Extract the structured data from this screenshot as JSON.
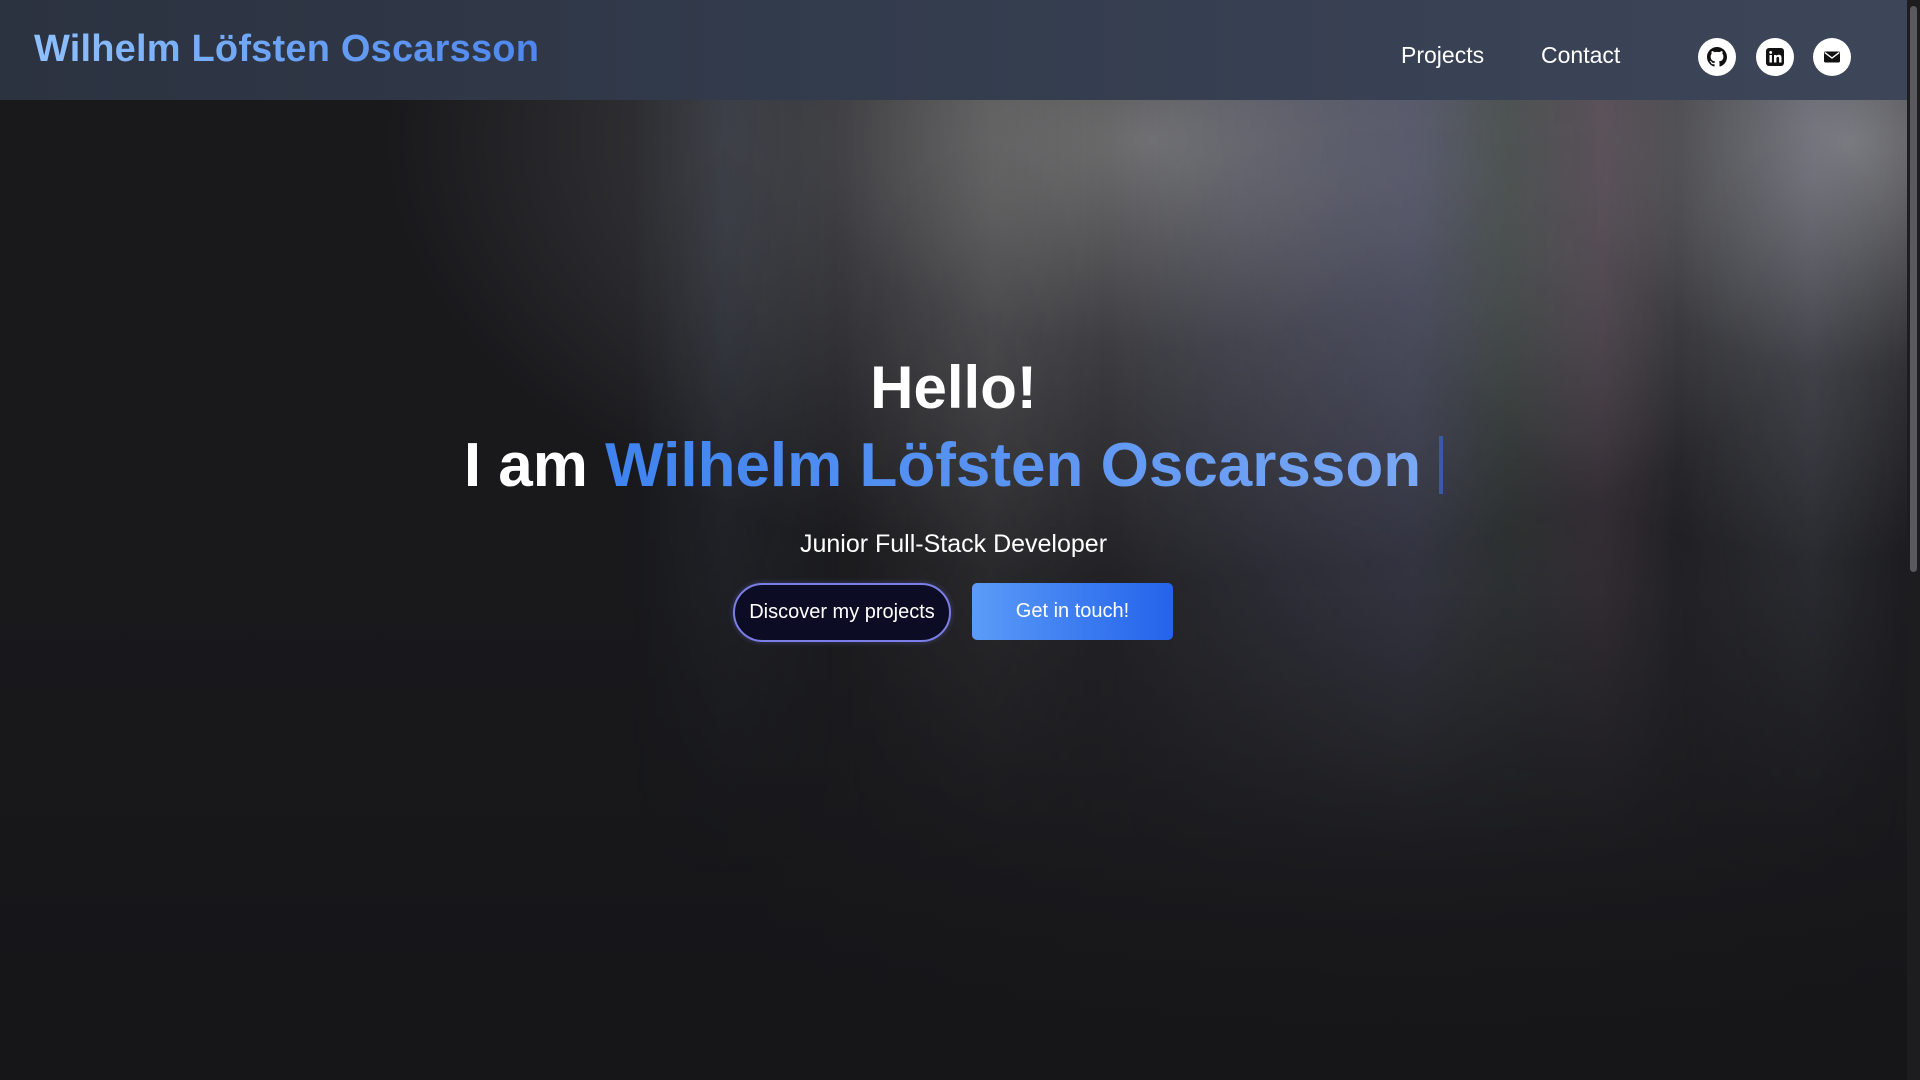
{
  "header": {
    "logo": "Wilhelm Löfsten Oscarsson",
    "nav": {
      "projects": "Projects",
      "contact": "Contact"
    },
    "social": [
      {
        "icon": "github-icon"
      },
      {
        "icon": "linkedin-icon"
      },
      {
        "icon": "mail-icon"
      }
    ]
  },
  "hero": {
    "greeting": "Hello!",
    "intro_prefix": "I am",
    "name": "Wilhelm Löfsten Oscarsson",
    "subtitle": "Junior Full-Stack Developer",
    "buttons": {
      "discover": "Discover my projects",
      "contact": "Get in touch!"
    }
  },
  "colors": {
    "accent_blue": "#3b7bf0",
    "logo_blue": "#6aa2f5",
    "header_bg": "#333c4d",
    "page_bg": "#18181b"
  }
}
